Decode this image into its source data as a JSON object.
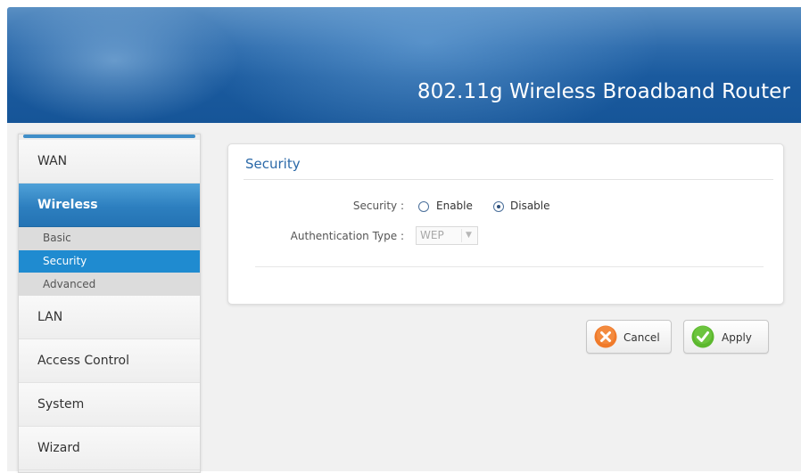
{
  "header": {
    "title": "802.11g Wireless Broadband Router"
  },
  "sidebar": {
    "items": [
      {
        "label": "WAN"
      },
      {
        "label": "Wireless",
        "active": true,
        "sub": [
          {
            "label": "Basic"
          },
          {
            "label": "Security",
            "active": true
          },
          {
            "label": "Advanced"
          }
        ]
      },
      {
        "label": "LAN"
      },
      {
        "label": "Access Control"
      },
      {
        "label": "System"
      },
      {
        "label": "Wizard"
      }
    ]
  },
  "panel": {
    "title": "Security",
    "security_label": "Security :",
    "options": [
      {
        "label": "Enable",
        "checked": false
      },
      {
        "label": "Disable",
        "checked": true
      }
    ],
    "auth_label": "Authentication Type :",
    "auth_value": "WEP"
  },
  "buttons": {
    "cancel": "Cancel",
    "apply": "Apply"
  },
  "colors": {
    "accent": "#2d7fbf",
    "title": "#2b69a8",
    "cancel_icon": "#f07a2a",
    "apply_icon": "#5cb82e"
  },
  "icons": {
    "cancel": "x-circle-icon",
    "apply": "check-circle-icon",
    "select_arrow": "chevron-down-icon"
  }
}
